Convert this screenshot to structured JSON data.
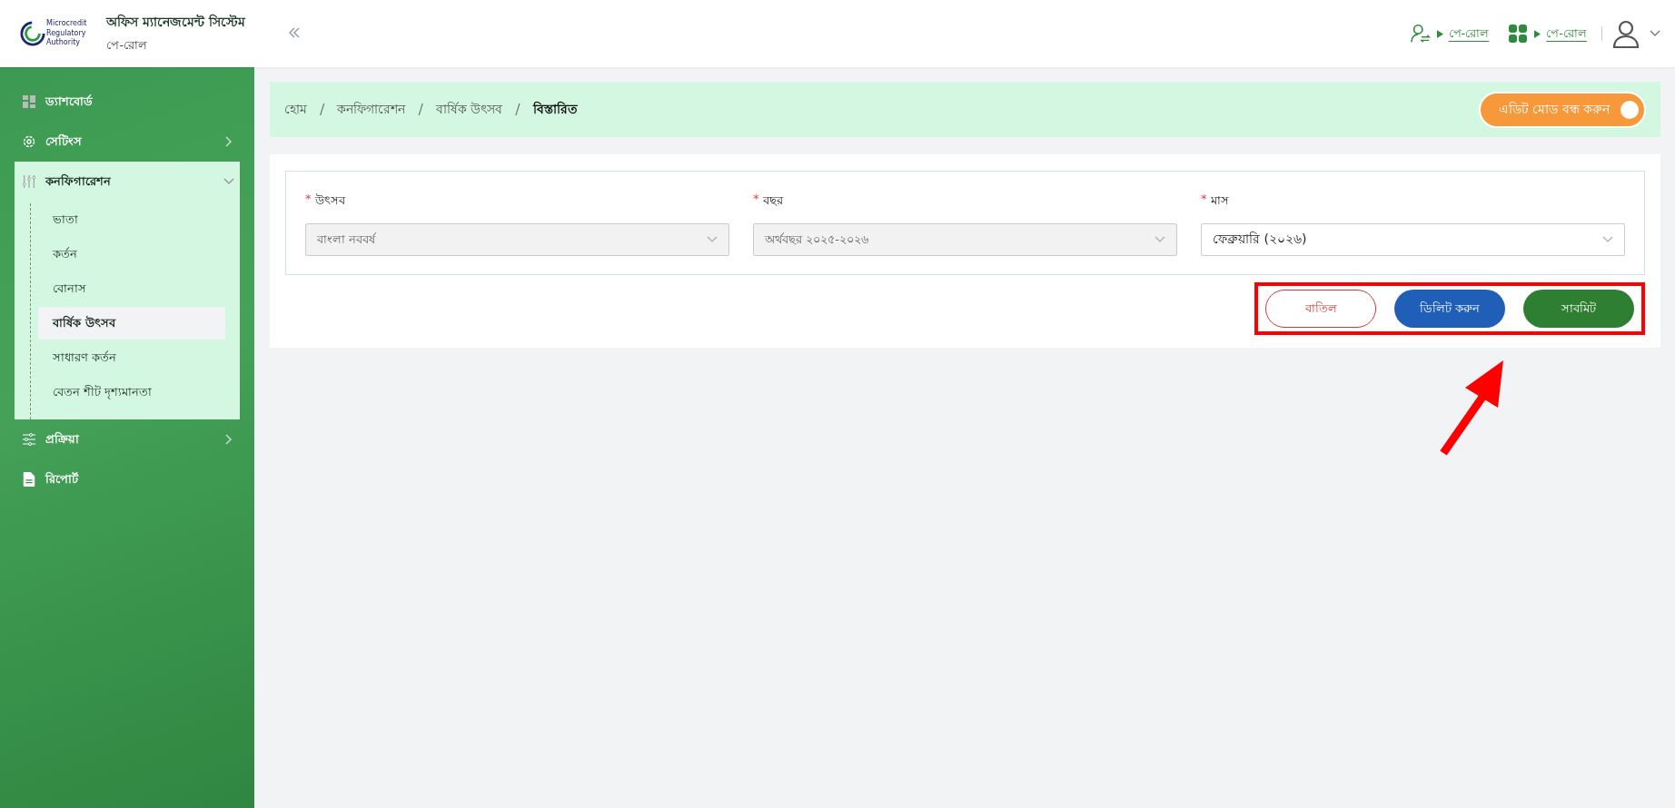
{
  "header": {
    "title": "অফিস ম্যানেজমেন্ট সিস্টেম",
    "subtitle": "পে-রোল",
    "logo_text": [
      "Microcredit",
      "Regulatory",
      "Authority"
    ],
    "links": [
      {
        "label": "পে-রোল"
      },
      {
        "label": "পে-রোল"
      }
    ]
  },
  "sidebar": {
    "items": [
      {
        "label": "ড্যাশবোর্ড",
        "expandable": false,
        "expanded": false
      },
      {
        "label": "সেটিংস",
        "expandable": true,
        "expanded": false
      },
      {
        "label": "কনফিগারেশন",
        "expandable": true,
        "expanded": true,
        "children": [
          {
            "label": "ভাতা",
            "selected": false
          },
          {
            "label": "কর্তন",
            "selected": false
          },
          {
            "label": "বোনাস",
            "selected": false
          },
          {
            "label": "বার্ষিক উৎসব",
            "selected": true
          },
          {
            "label": "সাধারণ কর্তন",
            "selected": false
          },
          {
            "label": "বেতন শীট দৃশ্যমানতা",
            "selected": false
          }
        ]
      },
      {
        "label": "প্রক্রিয়া",
        "expandable": true,
        "expanded": false
      },
      {
        "label": "রিপোর্ট",
        "expandable": false,
        "expanded": false
      }
    ]
  },
  "breadcrumb": [
    {
      "label": "হোম"
    },
    {
      "separator": "/",
      "label": "কনফিগারেশন"
    },
    {
      "separator": "/",
      "label": "বার্ষিক উৎসব"
    },
    {
      "separator": "/",
      "label": "বিস্তারিত"
    }
  ],
  "edit_mode": {
    "label": "এডিট মোড বন্ধ করুন",
    "on": true
  },
  "form": {
    "fields": [
      {
        "required_mark": "*",
        "label": "উৎসব",
        "value": "বাংলা নববর্ষ",
        "disabled": true
      },
      {
        "required_mark": "*",
        "label": "বছর",
        "value": "অর্থবছর ২০২৫-২০২৬",
        "disabled": true
      },
      {
        "required_mark": "*",
        "label": "মাস",
        "value": "ফেব্রুয়ারি (২০২৬)",
        "disabled": false
      }
    ]
  },
  "buttons": [
    {
      "kind": "cancel",
      "label": "বাতিল"
    },
    {
      "kind": "delete",
      "label": "ডিলিট করুন"
    },
    {
      "kind": "submit",
      "label": "সাবমিট"
    }
  ]
}
